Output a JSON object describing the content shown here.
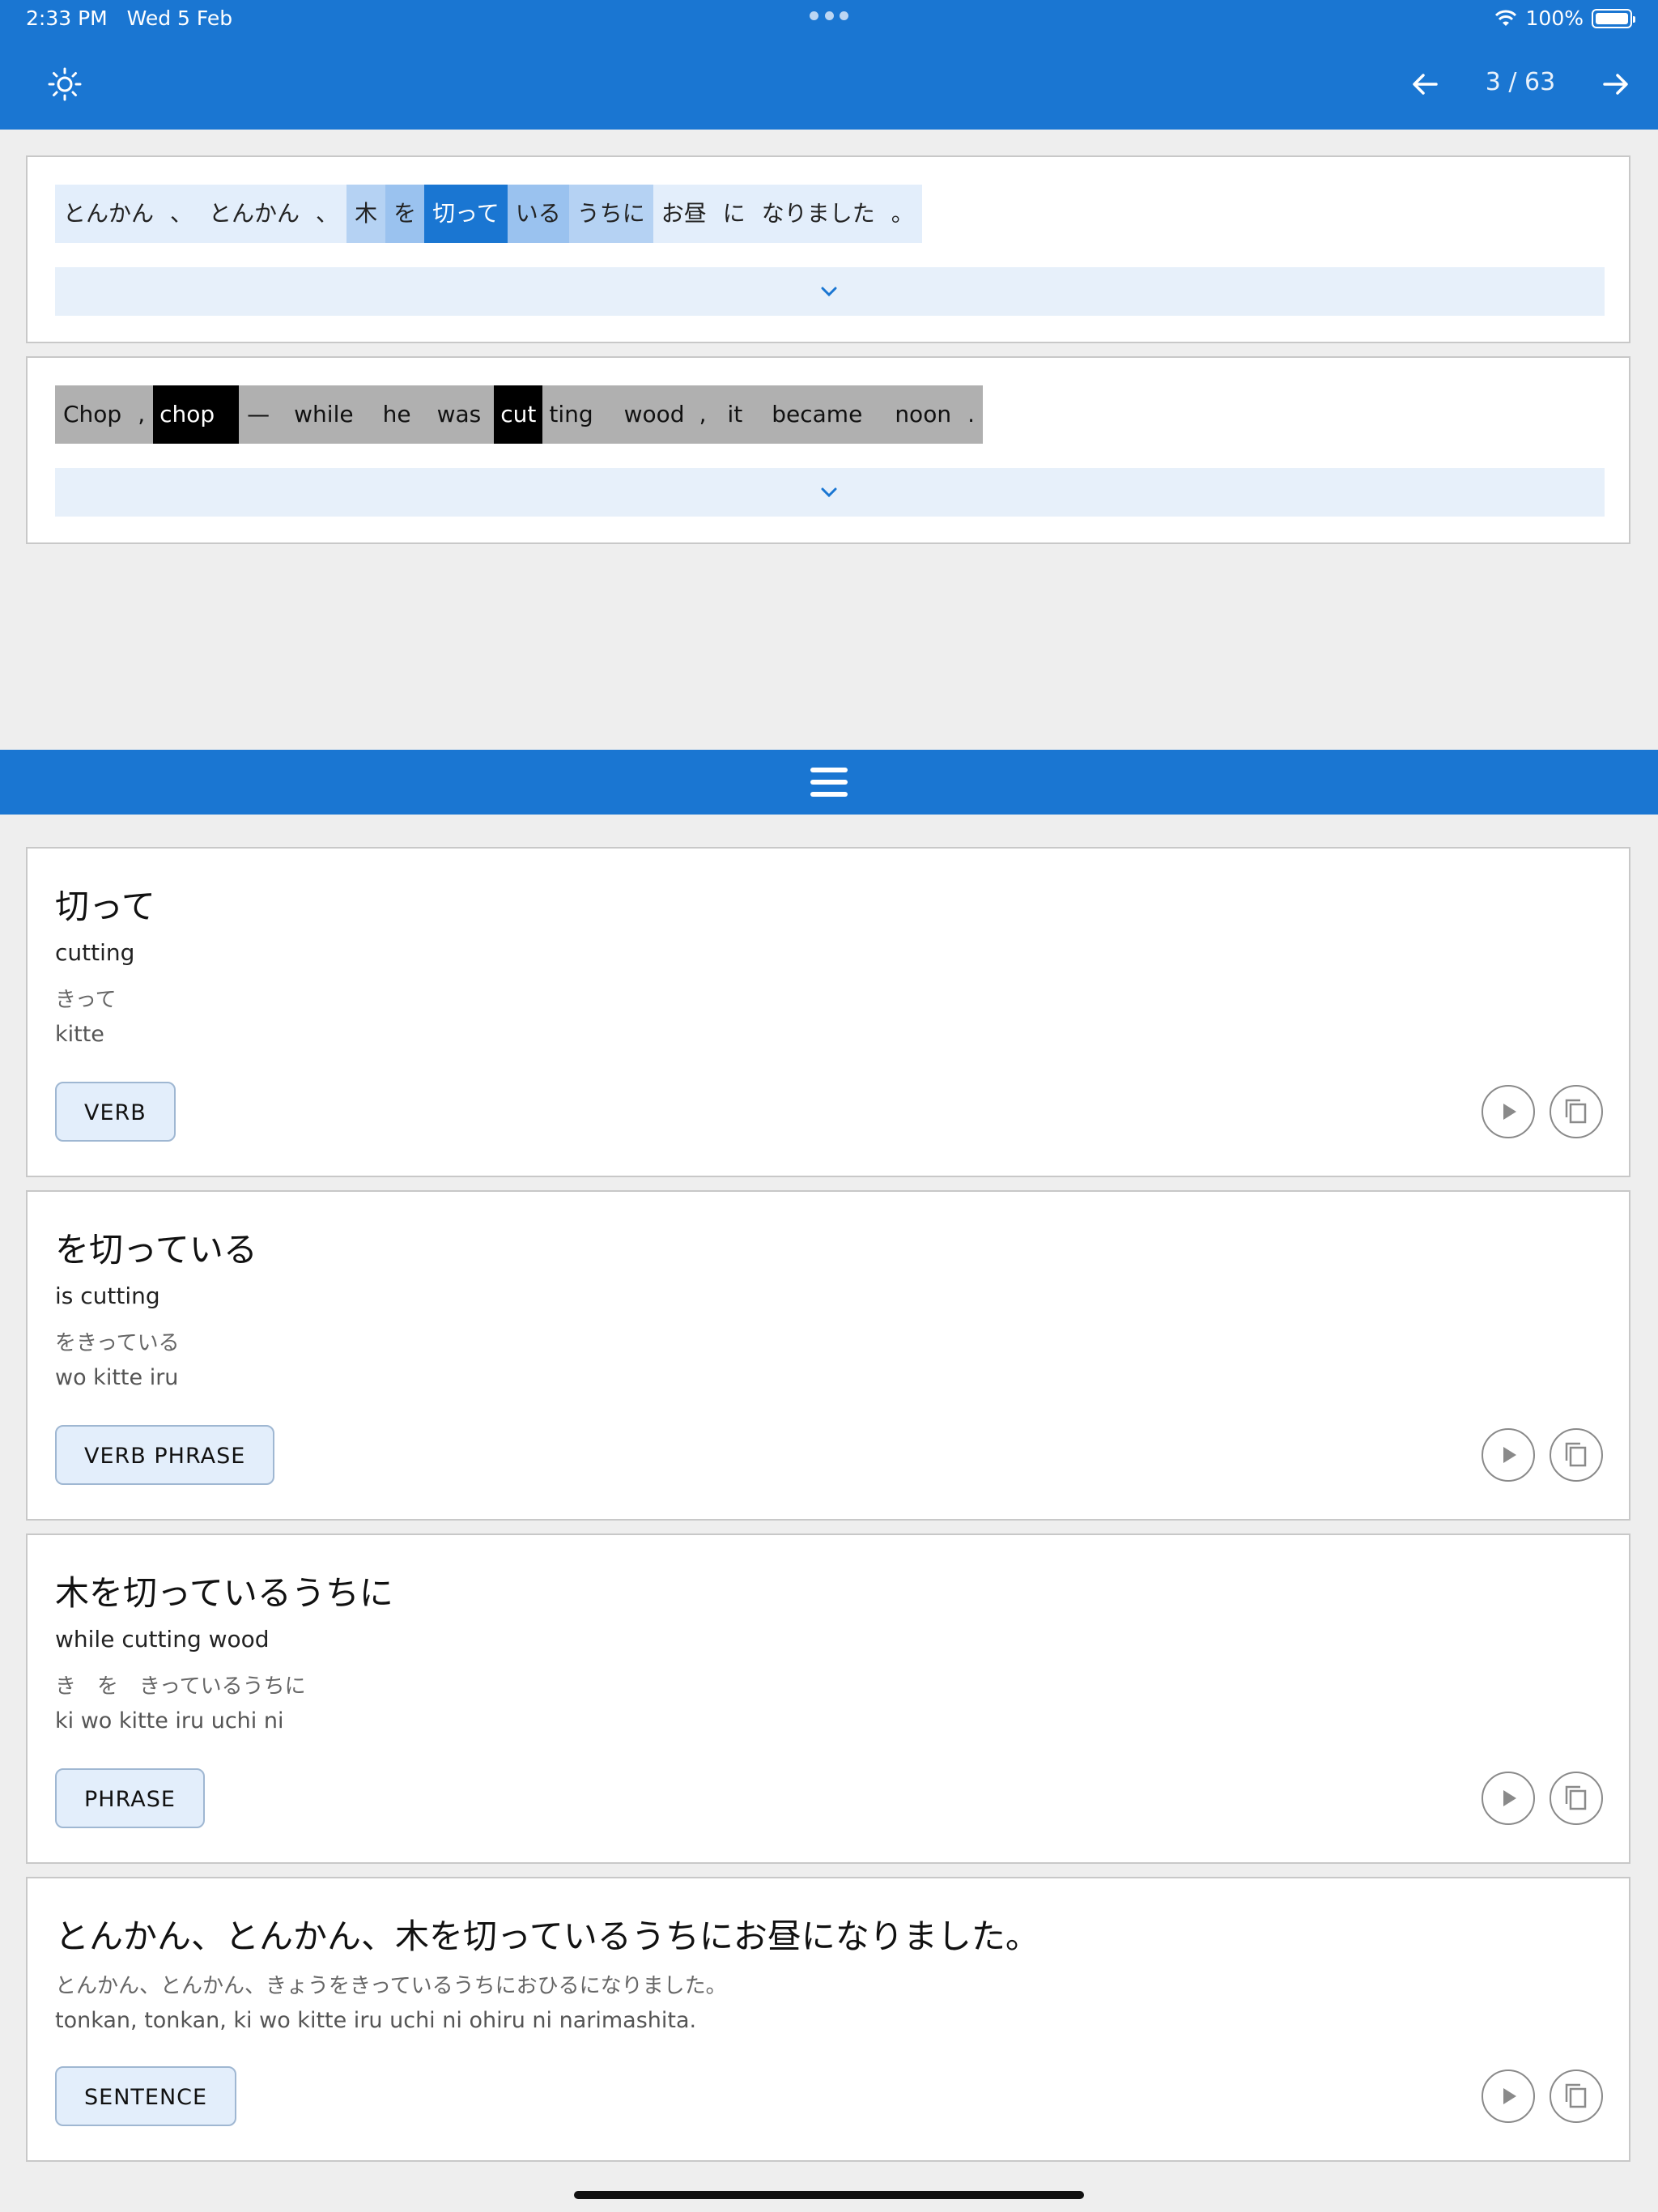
{
  "status": {
    "time": "2:33 PM",
    "date": "Wed 5 Feb",
    "battery": "100%"
  },
  "appbar": {
    "page_indicator": "3 / 63",
    "theme_icon": "sun-icon",
    "prev_icon": "arrow-left-icon",
    "next_icon": "arrow-right-icon"
  },
  "japanese_tokens": [
    "とんかん",
    "、",
    "とんかん",
    "、",
    "木",
    "を",
    "切って",
    "いる",
    "うちに",
    "お昼",
    "に",
    "なりました",
    "。"
  ],
  "english_tokens": [
    "Chop",
    ",",
    "chop",
    "—",
    "while",
    "he",
    "was",
    "cut",
    "ting",
    "wood",
    ",",
    "it",
    "became",
    "noon",
    "."
  ],
  "cards": [
    {
      "headword": "切って",
      "meaning": "cutting",
      "kana": "きって",
      "romaji": "kitte",
      "tag": "VERB"
    },
    {
      "headword": "を切っている",
      "meaning": "is cutting",
      "kana": "をきっている",
      "romaji": "wo kitte iru",
      "tag": "VERB PHRASE"
    },
    {
      "headword": "木を切っているうちに",
      "meaning": "while cutting wood",
      "kana": "き　を　きっているうちに",
      "romaji": "ki wo kitte iru uchi ni",
      "tag": "PHRASE"
    },
    {
      "headword": "とんかん、とんかん、木を切っているうちにお昼になりました。",
      "kana": "とんかん、とんかん、きょうをきっているうちにおひるになりました。",
      "romaji": "tonkan, tonkan, ki wo kitte iru uchi ni ohiru ni narimashita.",
      "tag": "SENTENCE"
    }
  ],
  "colors": {
    "primary": "#1a76d2",
    "highlight_light": "#e3eefb",
    "highlight_mid": "#9ac2ef",
    "english_token_bg": "#b0b0b0"
  }
}
